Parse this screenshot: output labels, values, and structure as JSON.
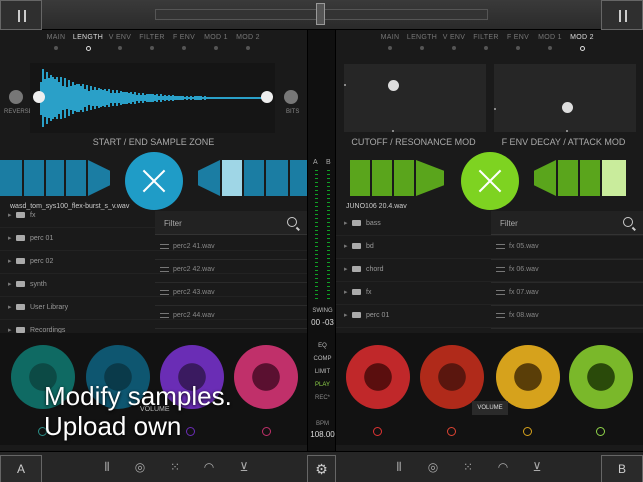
{
  "tabs_left": [
    "MAIN",
    "LENGTH",
    "V ENV",
    "FILTER",
    "F ENV",
    "MOD 1",
    "MOD 2"
  ],
  "tabs_left_active": "LENGTH",
  "tabs_right": [
    "MAIN",
    "LENGTH",
    "V ENV",
    "FILTER",
    "F ENV",
    "MOD 1",
    "MOD 2"
  ],
  "tabs_right_active": "MOD 2",
  "left": {
    "reverse_label": "REVERSE",
    "bits_label": "BITS",
    "zone_label": "START / END SAMPLE ZONE",
    "file_name": "wasd_tom_sys100_flex-burst_s_v.wav",
    "folders": [
      "fx",
      "perc 01",
      "perc 02",
      "synth",
      "User Library",
      "Recordings"
    ],
    "filter_placeholder": "Filter",
    "files": [
      "perc2 41.wav",
      "perc2 42.wav",
      "perc2 43.wav",
      "perc2 44.wav"
    ],
    "volume_label": "VOLUME",
    "accent": "#1f9cc7"
  },
  "right": {
    "pad1_label": "CUTOFF / RESONANCE MOD",
    "pad2_label": "F ENV DECAY / ATTACK MOD",
    "file_name": "JUNO106 20.4.wav",
    "folders": [
      "bass",
      "bd",
      "chord",
      "fx",
      "perc 01"
    ],
    "filter_placeholder": "Filter",
    "files": [
      "fx 05.wav",
      "fx 06.wav",
      "fx 07.wav",
      "fx 08.wav"
    ],
    "volume_label": "VOLUME",
    "accent": "#7ed321"
  },
  "mixer": {
    "meter_a": "A",
    "meter_b": "B",
    "swing_label": "SWING",
    "swing_value": "00 -03",
    "eq": "EQ",
    "comp": "COMP",
    "limit": "LIMIT",
    "play": "PLAY",
    "rec": "REC*",
    "bpm_label": "BPM",
    "bpm_value": "108.00"
  },
  "bottom": {
    "deck_a": "A",
    "deck_b": "B"
  },
  "overlay": {
    "line1": "Modify samples.",
    "line2": "Upload own"
  }
}
